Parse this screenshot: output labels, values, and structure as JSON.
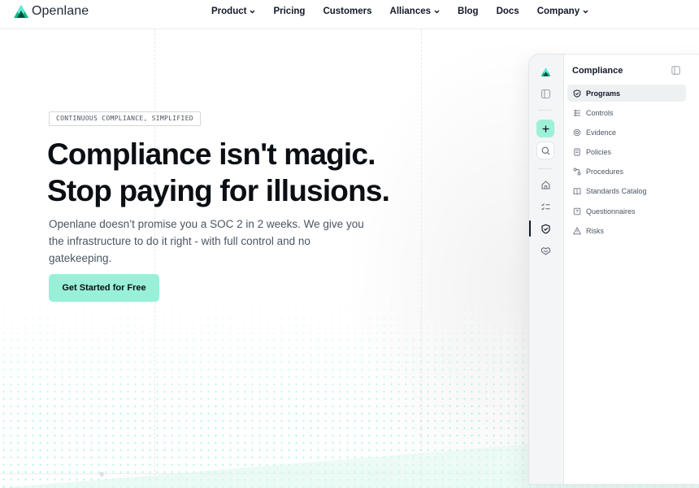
{
  "brand": {
    "name": "Openlane",
    "accent": "#2dd4a8",
    "accent_dark": "#0f766e",
    "cta_color": "#99f0d9"
  },
  "nav": {
    "items": [
      {
        "label": "Product",
        "has_dropdown": true
      },
      {
        "label": "Pricing",
        "has_dropdown": false
      },
      {
        "label": "Customers",
        "has_dropdown": false
      },
      {
        "label": "Alliances",
        "has_dropdown": true
      },
      {
        "label": "Blog",
        "has_dropdown": false
      },
      {
        "label": "Docs",
        "has_dropdown": false
      },
      {
        "label": "Company",
        "has_dropdown": true
      }
    ]
  },
  "hero": {
    "badge": "CONTINUOUS COMPLIANCE, SIMPLIFIED",
    "headline_line1": "Compliance isn't magic.",
    "headline_line2": "Stop paying for illusions.",
    "subtext": "Openlane doesn’t promise you a SOC 2 in 2 weeks. We give you the infrastructure to do it right - with full control and no gatekeeping.",
    "cta_label": "Get Started for Free"
  },
  "app": {
    "rail_icons": [
      "logo-icon",
      "layout-icon",
      "plus-icon",
      "search-icon",
      "home-icon",
      "tasks-icon",
      "shield-icon",
      "handshake-icon"
    ],
    "panel_title": "Compliance",
    "items": [
      {
        "label": "Programs",
        "icon": "shield-check-icon",
        "active": true
      },
      {
        "label": "Controls",
        "icon": "controls-icon",
        "active": false
      },
      {
        "label": "Evidence",
        "icon": "evidence-icon",
        "active": false
      },
      {
        "label": "Policies",
        "icon": "policies-icon",
        "active": false
      },
      {
        "label": "Procedures",
        "icon": "procedures-icon",
        "active": false
      },
      {
        "label": "Standards Catalog",
        "icon": "book-icon",
        "active": false
      },
      {
        "label": "Questionnaires",
        "icon": "questionnaire-icon",
        "active": false
      },
      {
        "label": "Risks",
        "icon": "warning-icon",
        "active": false
      }
    ]
  }
}
